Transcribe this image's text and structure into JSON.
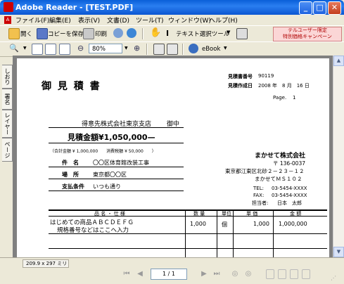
{
  "window": {
    "title": "Adobe Reader - [TEST.PDF]",
    "min": "_",
    "max": "□",
    "close": "✕"
  },
  "menu": [
    "ファイル(F)",
    "編集(E)",
    "表示(V)",
    "文書(D)",
    "ツール(T)",
    "ウィンドウ(W)",
    "ヘルプ(H)"
  ],
  "toolbar1": {
    "open": "開く",
    "save_copy": "コピーを保存",
    "print": "印刷",
    "select_text": "テキスト選択ツール",
    "promo_line1": "テルユーザー限定",
    "promo_line2": "特別価格キャンペーン"
  },
  "toolbar2": {
    "zoom": "80%",
    "ebook": "eBook"
  },
  "side_tabs": [
    "しおり",
    "署名",
    "レイヤー",
    "ページ"
  ],
  "document": {
    "title": "御 見 積 書",
    "quote_no_label": "見積書番号",
    "quote_no": "90119",
    "date_label": "見積作成日",
    "date": "2008 年　8 月　16 日",
    "page_label": "Page.",
    "page_no": "1",
    "recipient": "得意先株式会社東京支店",
    "honorific": "御中",
    "amount": "見積金額¥1,050,000—",
    "total_note": "（合計金額 ¥ 1,000,000　　消費税額 ¥ 50,000　　）",
    "subject_label": "件　名",
    "subject": "〇〇区体育館改装工事",
    "place_label": "場　所",
    "place": "東京都〇〇区",
    "terms_label": "支払条件",
    "terms": "いつも通り",
    "company": "まかせて株式会社",
    "postal": "〒 136-0037",
    "address1": "東京都江東区北砂２－２３－１２",
    "address2": "まかせてＭＳ１０２",
    "tel_label": "TEL:",
    "tel": "03-5454-XXXX",
    "fax_label": "FAX:",
    "fax": "03-5454-XXXX",
    "person_label": "担当者:",
    "person": "日本　太郎",
    "table_headers": [
      "品 名 ・ 仕 様",
      "数 量",
      "単位",
      "単 価",
      "金 額"
    ],
    "row1": {
      "name": "はじめての商品ＡＢＣＤＥＦＧ",
      "spec": "規格番号などはここへ入力",
      "qty": "1,000",
      "unit": "個",
      "price": "1,000",
      "amount": "1,000,000"
    }
  },
  "status": {
    "page_size": "209.9 x 297 ミリ",
    "page_indicator": "1 / 1"
  }
}
